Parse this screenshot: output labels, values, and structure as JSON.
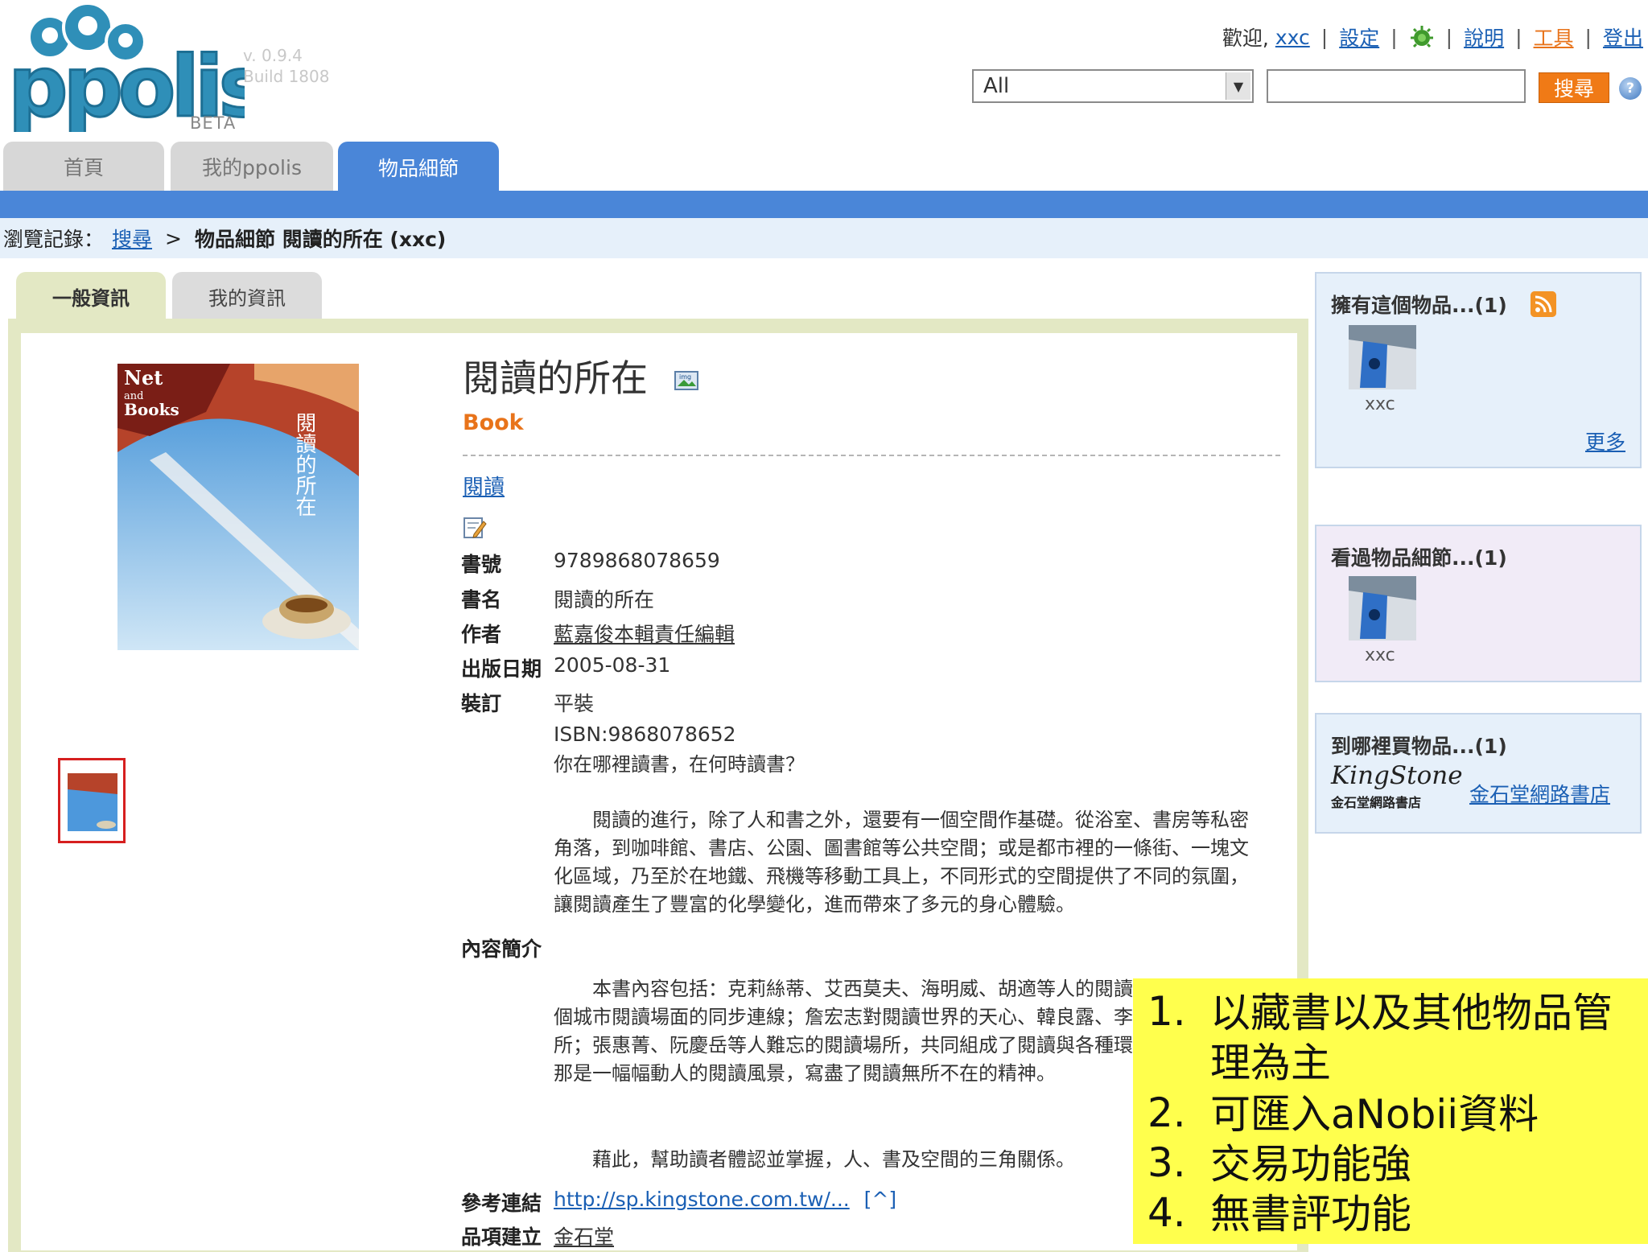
{
  "logo": {
    "name": "ppolis",
    "version": "v. 0.9.4",
    "build": "Build 1808",
    "beta": "BETA"
  },
  "topnav": {
    "welcome": "歡迎,",
    "user": "xxc",
    "settings": "設定",
    "help": "說明",
    "tools": "工具",
    "logout": "登出"
  },
  "search": {
    "scope": "All",
    "query": "",
    "button": "搜尋"
  },
  "main_tabs": [
    {
      "label": "首頁",
      "active": false
    },
    {
      "label": "我的ppolis",
      "active": false
    },
    {
      "label": "物品細節",
      "active": true
    }
  ],
  "breadcrumb": {
    "label": "瀏覽記錄：",
    "search_link": "搜尋",
    "separator": ">",
    "current": "物品細節 閱讀的所在 (xxc)"
  },
  "sub_tabs": [
    {
      "label": "一般資訊",
      "active": true
    },
    {
      "label": "我的資訊",
      "active": false
    }
  ],
  "item": {
    "title": "閱讀的所在",
    "type": "Book",
    "tag": "閱讀",
    "fields": {
      "book_no_label": "書號",
      "book_no": "9789868078659",
      "name_label": "書名",
      "name": "閱讀的所在",
      "author_label": "作者",
      "author": "藍嘉俊本輯責任編輯",
      "date_label": "出版日期",
      "date": "2005-08-31",
      "binding_label": "裝訂",
      "binding": "平裝",
      "isbn": "ISBN:9868078652",
      "summary_label": "內容簡介",
      "ref_label": "參考連結",
      "ref_link": "http://sp.kingstone.com.tw/...",
      "ref_up": "[^]",
      "created_label": "品項建立",
      "created_by": "金石堂"
    },
    "summary": {
      "q": "你在哪裡讀書，在何時讀書？",
      "p1": "　　閱讀的進行，除了人和書之外，還要有一個空間作基礎。從浴室、書房等私密角落，到咖啡館、書店、公園、圖書館等公共空間；或是都市裡的一條街、一塊文化區域，乃至於在地鐵、飛機等移動工具上，不同形式的空間提供了不同的氛圍，讓閱讀產生了豐富的化學變化，進而帶來了多元的身心體驗。",
      "p2": "　　本書內容包括：克莉絲蒂、艾西莫夫、海明威、胡適等人的閱讀停格；全球17個城市閱讀場面的同步連線；詹宏志對閱讀世界的天心、韓良露、李欣頻的閱讀場所；張惠菁、阮慶岳等人難忘的閱讀場所，共同組成了閱讀與各種環境的交響曲，那是一幅幅動人的閱讀風景，寫盡了閱讀無所不在的精神。",
      "p3": "　　藉此，幫助讀者體認並掌握，人、書及空間的三角關係。"
    }
  },
  "sidebar": {
    "owners": {
      "title": "擁有這個物品...(1)",
      "user": "xxc",
      "more": "更多"
    },
    "viewers": {
      "title": "看過物品細節...(1)",
      "user": "xxc"
    },
    "buy": {
      "title": "到哪裡買物品...(1)",
      "store_logo": "KingStone",
      "store_logo_sub": "金石堂網路書店",
      "store_link": "金石堂網路書店"
    }
  },
  "overlay_notes": [
    {
      "num": "1.",
      "text": "以藏書以及其他物品管理為主"
    },
    {
      "num": "2.",
      "text": "可匯入aNobii資料"
    },
    {
      "num": "3.",
      "text": "交易功能強"
    },
    {
      "num": "4.",
      "text": "無書評功能"
    }
  ],
  "colors": {
    "tab_blue": "#4a86d8",
    "orange": "#f07a16",
    "panel_green": "#e3e8c4",
    "note_yellow": "#ffff4d"
  }
}
